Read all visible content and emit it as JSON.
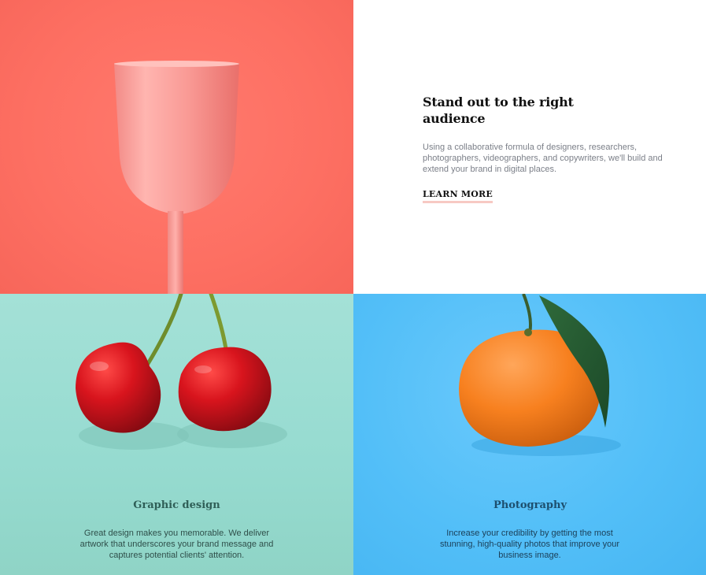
{
  "intro": {
    "title": "Stand out to the right audience",
    "body": "Using a collaborative formula of designers, researchers, photographers, videographers, and copywriters, we'll build and extend your brand in digital places.",
    "cta_label": "LEARN MORE"
  },
  "cards": [
    {
      "title": "Graphic design",
      "text": "Great design makes you memorable. We deliver artwork that underscores your brand message and captures potential clients' attention.",
      "image": "cherries-image"
    },
    {
      "title": "Photography",
      "text": "Increase your credibility by getting the most stunning, high-quality photos that improve your business image.",
      "image": "orange-image"
    }
  ],
  "images": {
    "top_left": "pink-glass-image"
  },
  "colors": {
    "coral": "#fd6f62",
    "mint": "#96dbd0",
    "sky": "#53bff8",
    "link_underline": "#f7c9c3",
    "heading": "#111111",
    "body_text": "#7b7f88"
  }
}
